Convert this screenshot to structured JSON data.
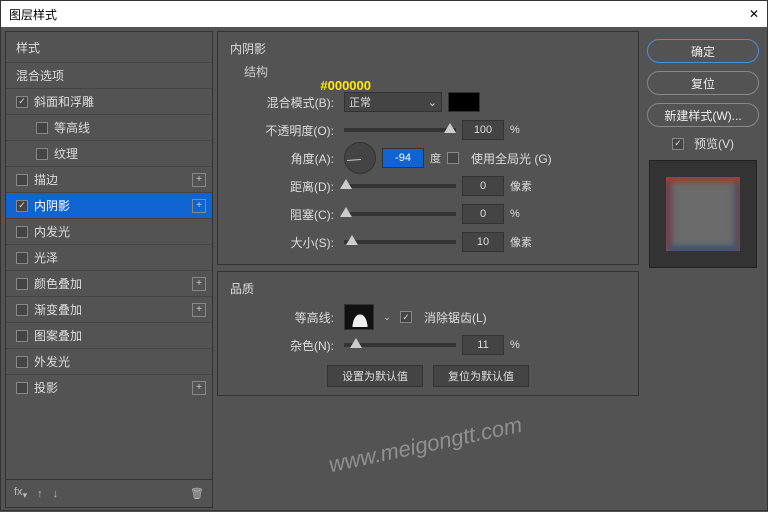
{
  "title": "图层样式",
  "hex_annotation": "#000000",
  "left": {
    "header": "样式",
    "items": [
      {
        "label": "混合选项",
        "check": null,
        "sub": false,
        "plus": false,
        "sel": false
      },
      {
        "label": "斜面和浮雕",
        "check": true,
        "sub": false,
        "plus": false,
        "sel": false
      },
      {
        "label": "等高线",
        "check": false,
        "sub": true,
        "plus": false,
        "sel": false
      },
      {
        "label": "纹理",
        "check": false,
        "sub": true,
        "plus": false,
        "sel": false
      },
      {
        "label": "描边",
        "check": false,
        "sub": false,
        "plus": true,
        "sel": false
      },
      {
        "label": "内阴影",
        "check": true,
        "sub": false,
        "plus": true,
        "sel": true
      },
      {
        "label": "内发光",
        "check": false,
        "sub": false,
        "plus": false,
        "sel": false
      },
      {
        "label": "光泽",
        "check": false,
        "sub": false,
        "plus": false,
        "sel": false
      },
      {
        "label": "颜色叠加",
        "check": false,
        "sub": false,
        "plus": true,
        "sel": false
      },
      {
        "label": "渐变叠加",
        "check": false,
        "sub": false,
        "plus": true,
        "sel": false
      },
      {
        "label": "图案叠加",
        "check": false,
        "sub": false,
        "plus": false,
        "sel": false
      },
      {
        "label": "外发光",
        "check": false,
        "sub": false,
        "plus": false,
        "sel": false
      },
      {
        "label": "投影",
        "check": false,
        "sub": false,
        "plus": true,
        "sel": false
      }
    ],
    "footer_fx": "fx"
  },
  "mid": {
    "panel_title": "内阴影",
    "structure_title": "结构",
    "blend_label": "混合模式(B):",
    "blend_value": "正常",
    "opacity_label": "不透明度(O):",
    "opacity_value": "100",
    "opacity_unit": "%",
    "angle_label": "角度(A):",
    "angle_value": "-94",
    "angle_unit": "度",
    "global_light": "使用全局光 (G)",
    "distance_label": "距离(D):",
    "distance_value": "0",
    "distance_unit": "像素",
    "choke_label": "阻塞(C):",
    "choke_value": "0",
    "choke_unit": "%",
    "size_label": "大小(S):",
    "size_value": "10",
    "size_unit": "像素",
    "quality_title": "品质",
    "contour_label": "等高线:",
    "antialias": "消除锯齿(L)",
    "noise_label": "杂色(N):",
    "noise_value": "11",
    "noise_unit": "%",
    "btn_default": "设置为默认值",
    "btn_reset": "复位为默认值"
  },
  "right": {
    "ok": "确定",
    "cancel": "复位",
    "new_style": "新建样式(W)...",
    "preview": "预览(V)"
  },
  "watermark": "www.meigongtt.com"
}
